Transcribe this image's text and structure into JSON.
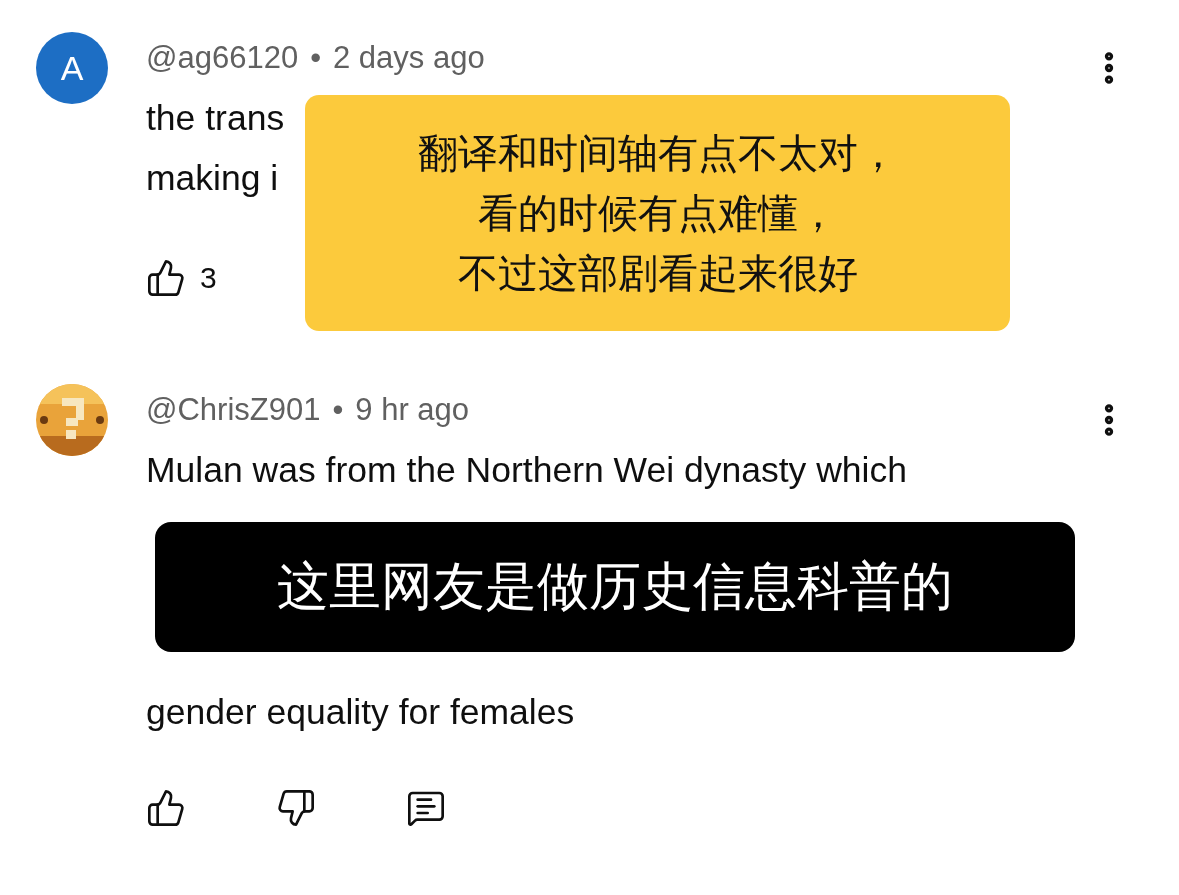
{
  "comments": [
    {
      "avatar": {
        "kind": "letter",
        "letter": "A"
      },
      "author": "@ag66120",
      "separator": "•",
      "time": "2 days ago",
      "body": [
        {
          "kind": "line",
          "text": "the trans"
        },
        {
          "kind": "line",
          "text": "making i"
        },
        {
          "kind": "note",
          "lines": [
            "翻译和时间轴有点不太对，",
            "看的时候有点难懂，",
            "不过这部剧看起来很好"
          ]
        }
      ],
      "actions": [
        {
          "kind": "like",
          "count": "3"
        }
      ]
    },
    {
      "author": "@ChrisZ901",
      "separator": "•",
      "time": "9 hr ago",
      "body": [
        {
          "kind": "line",
          "text": "Mulan was from the Northern Wei dynasty which"
        },
        {
          "kind": "caption",
          "lines": [
            "这里网友是做历史信息科普的"
          ]
        },
        {
          "kind": "line",
          "text": "gender equality for females"
        }
      ],
      "actions": [
        {
          "kind": "like"
        },
        {
          "kind": "dislike"
        },
        {
          "kind": "reply"
        }
      ]
    }
  ]
}
